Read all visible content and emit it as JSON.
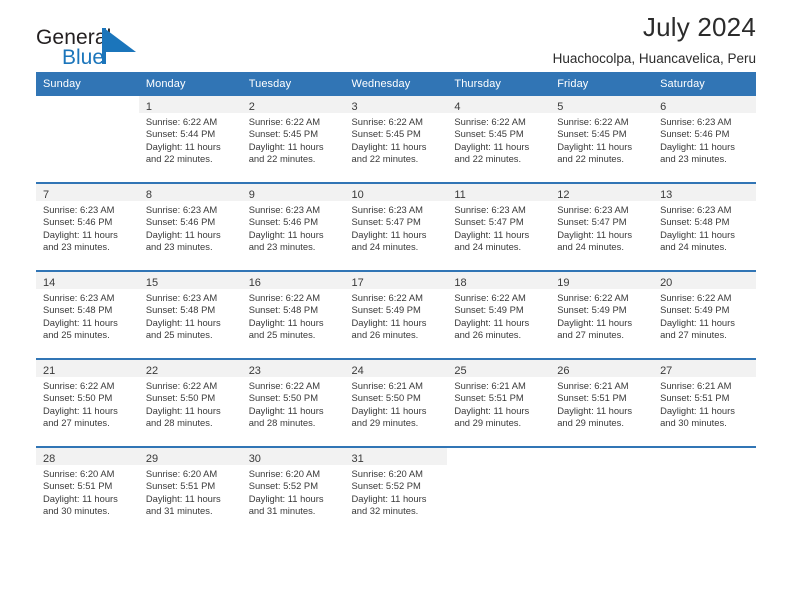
{
  "logo": {
    "text_primary": "General",
    "text_secondary": "Blue",
    "mark": "triangle-flag-icon",
    "color_primary": "#231f20",
    "color_secondary": "#1b75bb"
  },
  "header": {
    "title": "July 2024",
    "subtitle": "Huachocolpa, Huancavelica, Peru"
  },
  "theme": {
    "header_bg": "#3175b5",
    "header_text": "#ffffff",
    "shaded_cell": "#f2f2f2",
    "body_text": "#3a3a3a"
  },
  "weekdays": [
    "Sunday",
    "Monday",
    "Tuesday",
    "Wednesday",
    "Thursday",
    "Friday",
    "Saturday"
  ],
  "weeks": [
    [
      {
        "day": "",
        "empty": true
      },
      {
        "day": "1",
        "sunrise": "Sunrise: 6:22 AM",
        "sunset": "Sunset: 5:44 PM",
        "daylight1": "Daylight: 11 hours",
        "daylight2": "and 22 minutes."
      },
      {
        "day": "2",
        "sunrise": "Sunrise: 6:22 AM",
        "sunset": "Sunset: 5:45 PM",
        "daylight1": "Daylight: 11 hours",
        "daylight2": "and 22 minutes."
      },
      {
        "day": "3",
        "sunrise": "Sunrise: 6:22 AM",
        "sunset": "Sunset: 5:45 PM",
        "daylight1": "Daylight: 11 hours",
        "daylight2": "and 22 minutes."
      },
      {
        "day": "4",
        "sunrise": "Sunrise: 6:22 AM",
        "sunset": "Sunset: 5:45 PM",
        "daylight1": "Daylight: 11 hours",
        "daylight2": "and 22 minutes."
      },
      {
        "day": "5",
        "sunrise": "Sunrise: 6:22 AM",
        "sunset": "Sunset: 5:45 PM",
        "daylight1": "Daylight: 11 hours",
        "daylight2": "and 22 minutes."
      },
      {
        "day": "6",
        "sunrise": "Sunrise: 6:23 AM",
        "sunset": "Sunset: 5:46 PM",
        "daylight1": "Daylight: 11 hours",
        "daylight2": "and 23 minutes."
      }
    ],
    [
      {
        "day": "7",
        "sunrise": "Sunrise: 6:23 AM",
        "sunset": "Sunset: 5:46 PM",
        "daylight1": "Daylight: 11 hours",
        "daylight2": "and 23 minutes."
      },
      {
        "day": "8",
        "sunrise": "Sunrise: 6:23 AM",
        "sunset": "Sunset: 5:46 PM",
        "daylight1": "Daylight: 11 hours",
        "daylight2": "and 23 minutes."
      },
      {
        "day": "9",
        "sunrise": "Sunrise: 6:23 AM",
        "sunset": "Sunset: 5:46 PM",
        "daylight1": "Daylight: 11 hours",
        "daylight2": "and 23 minutes."
      },
      {
        "day": "10",
        "sunrise": "Sunrise: 6:23 AM",
        "sunset": "Sunset: 5:47 PM",
        "daylight1": "Daylight: 11 hours",
        "daylight2": "and 24 minutes."
      },
      {
        "day": "11",
        "sunrise": "Sunrise: 6:23 AM",
        "sunset": "Sunset: 5:47 PM",
        "daylight1": "Daylight: 11 hours",
        "daylight2": "and 24 minutes."
      },
      {
        "day": "12",
        "sunrise": "Sunrise: 6:23 AM",
        "sunset": "Sunset: 5:47 PM",
        "daylight1": "Daylight: 11 hours",
        "daylight2": "and 24 minutes."
      },
      {
        "day": "13",
        "sunrise": "Sunrise: 6:23 AM",
        "sunset": "Sunset: 5:48 PM",
        "daylight1": "Daylight: 11 hours",
        "daylight2": "and 24 minutes."
      }
    ],
    [
      {
        "day": "14",
        "sunrise": "Sunrise: 6:23 AM",
        "sunset": "Sunset: 5:48 PM",
        "daylight1": "Daylight: 11 hours",
        "daylight2": "and 25 minutes."
      },
      {
        "day": "15",
        "sunrise": "Sunrise: 6:23 AM",
        "sunset": "Sunset: 5:48 PM",
        "daylight1": "Daylight: 11 hours",
        "daylight2": "and 25 minutes."
      },
      {
        "day": "16",
        "sunrise": "Sunrise: 6:22 AM",
        "sunset": "Sunset: 5:48 PM",
        "daylight1": "Daylight: 11 hours",
        "daylight2": "and 25 minutes."
      },
      {
        "day": "17",
        "sunrise": "Sunrise: 6:22 AM",
        "sunset": "Sunset: 5:49 PM",
        "daylight1": "Daylight: 11 hours",
        "daylight2": "and 26 minutes."
      },
      {
        "day": "18",
        "sunrise": "Sunrise: 6:22 AM",
        "sunset": "Sunset: 5:49 PM",
        "daylight1": "Daylight: 11 hours",
        "daylight2": "and 26 minutes."
      },
      {
        "day": "19",
        "sunrise": "Sunrise: 6:22 AM",
        "sunset": "Sunset: 5:49 PM",
        "daylight1": "Daylight: 11 hours",
        "daylight2": "and 27 minutes."
      },
      {
        "day": "20",
        "sunrise": "Sunrise: 6:22 AM",
        "sunset": "Sunset: 5:49 PM",
        "daylight1": "Daylight: 11 hours",
        "daylight2": "and 27 minutes."
      }
    ],
    [
      {
        "day": "21",
        "sunrise": "Sunrise: 6:22 AM",
        "sunset": "Sunset: 5:50 PM",
        "daylight1": "Daylight: 11 hours",
        "daylight2": "and 27 minutes."
      },
      {
        "day": "22",
        "sunrise": "Sunrise: 6:22 AM",
        "sunset": "Sunset: 5:50 PM",
        "daylight1": "Daylight: 11 hours",
        "daylight2": "and 28 minutes."
      },
      {
        "day": "23",
        "sunrise": "Sunrise: 6:22 AM",
        "sunset": "Sunset: 5:50 PM",
        "daylight1": "Daylight: 11 hours",
        "daylight2": "and 28 minutes."
      },
      {
        "day": "24",
        "sunrise": "Sunrise: 6:21 AM",
        "sunset": "Sunset: 5:50 PM",
        "daylight1": "Daylight: 11 hours",
        "daylight2": "and 29 minutes."
      },
      {
        "day": "25",
        "sunrise": "Sunrise: 6:21 AM",
        "sunset": "Sunset: 5:51 PM",
        "daylight1": "Daylight: 11 hours",
        "daylight2": "and 29 minutes."
      },
      {
        "day": "26",
        "sunrise": "Sunrise: 6:21 AM",
        "sunset": "Sunset: 5:51 PM",
        "daylight1": "Daylight: 11 hours",
        "daylight2": "and 29 minutes."
      },
      {
        "day": "27",
        "sunrise": "Sunrise: 6:21 AM",
        "sunset": "Sunset: 5:51 PM",
        "daylight1": "Daylight: 11 hours",
        "daylight2": "and 30 minutes."
      }
    ],
    [
      {
        "day": "28",
        "sunrise": "Sunrise: 6:20 AM",
        "sunset": "Sunset: 5:51 PM",
        "daylight1": "Daylight: 11 hours",
        "daylight2": "and 30 minutes."
      },
      {
        "day": "29",
        "sunrise": "Sunrise: 6:20 AM",
        "sunset": "Sunset: 5:51 PM",
        "daylight1": "Daylight: 11 hours",
        "daylight2": "and 31 minutes."
      },
      {
        "day": "30",
        "sunrise": "Sunrise: 6:20 AM",
        "sunset": "Sunset: 5:52 PM",
        "daylight1": "Daylight: 11 hours",
        "daylight2": "and 31 minutes."
      },
      {
        "day": "31",
        "sunrise": "Sunrise: 6:20 AM",
        "sunset": "Sunset: 5:52 PM",
        "daylight1": "Daylight: 11 hours",
        "daylight2": "and 32 minutes."
      },
      {
        "day": "",
        "empty": true
      },
      {
        "day": "",
        "empty": true
      },
      {
        "day": "",
        "empty": true
      }
    ]
  ]
}
